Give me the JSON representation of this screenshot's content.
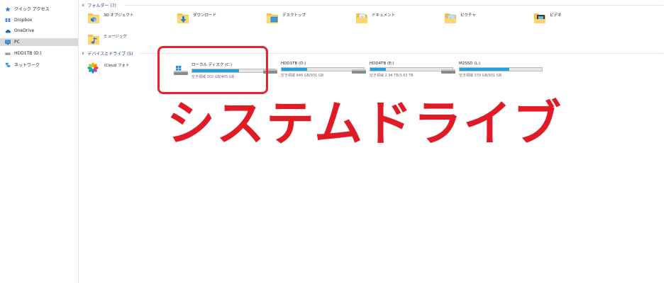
{
  "nav": {
    "items": [
      {
        "label": "クイック アクセス",
        "icon": "star-icon"
      },
      {
        "label": "Dropbox",
        "icon": "dropbox-icon"
      },
      {
        "label": "OneDrive",
        "icon": "cloud-icon"
      },
      {
        "label": "PC",
        "icon": "monitor-icon",
        "selected": true
      },
      {
        "label": "HDD1TB (D:)",
        "icon": "drive-icon"
      },
      {
        "label": "ネットワーク",
        "icon": "network-icon"
      }
    ]
  },
  "sections": {
    "folders": {
      "title": "フォルダー (7)"
    },
    "devices": {
      "title": "デバイスとドライブ (5)"
    }
  },
  "folders": [
    {
      "label": "3D オブジェクト",
      "icon": "3d-objects-folder-icon"
    },
    {
      "label": "ダウンロード",
      "icon": "downloads-folder-icon"
    },
    {
      "label": "デスクトップ",
      "icon": "desktop-folder-icon"
    },
    {
      "label": "ドキュメント",
      "icon": "documents-folder-icon"
    },
    {
      "label": "ピクチャ",
      "icon": "pictures-folder-icon"
    },
    {
      "label": "ビデオ",
      "icon": "videos-folder-icon"
    },
    {
      "label": "ミュージック",
      "icon": "music-folder-icon"
    }
  ],
  "icloud": {
    "label": "iCloud フォト",
    "icon": "icloud-photos-icon"
  },
  "drives": [
    {
      "name": "ローカル ディスク (C:)",
      "space": "空き領域 202 GB/465 GB",
      "used_fraction": 0.57,
      "icon": "windows-drive-icon"
    },
    {
      "name": "HDD1TB (D:)",
      "space": "空き領域 646 GB/931 GB",
      "used_fraction": 0.31,
      "icon": "drive-icon"
    },
    {
      "name": "HDD4TB (E:)",
      "space": "空き領域 2.94 TB/3.63 TB",
      "used_fraction": 0.19,
      "icon": "drive-icon"
    },
    {
      "name": "M2SSD (L:)",
      "space": "空き領域 370 GB/931 GB",
      "used_fraction": 0.6,
      "icon": "drive-icon"
    }
  ],
  "annotation": {
    "text": "システムドライブ",
    "color": "#e11b25"
  },
  "colors": {
    "accent": "#26a0da",
    "highlight": "#e8232d",
    "section_header": "#1e3f8c"
  }
}
